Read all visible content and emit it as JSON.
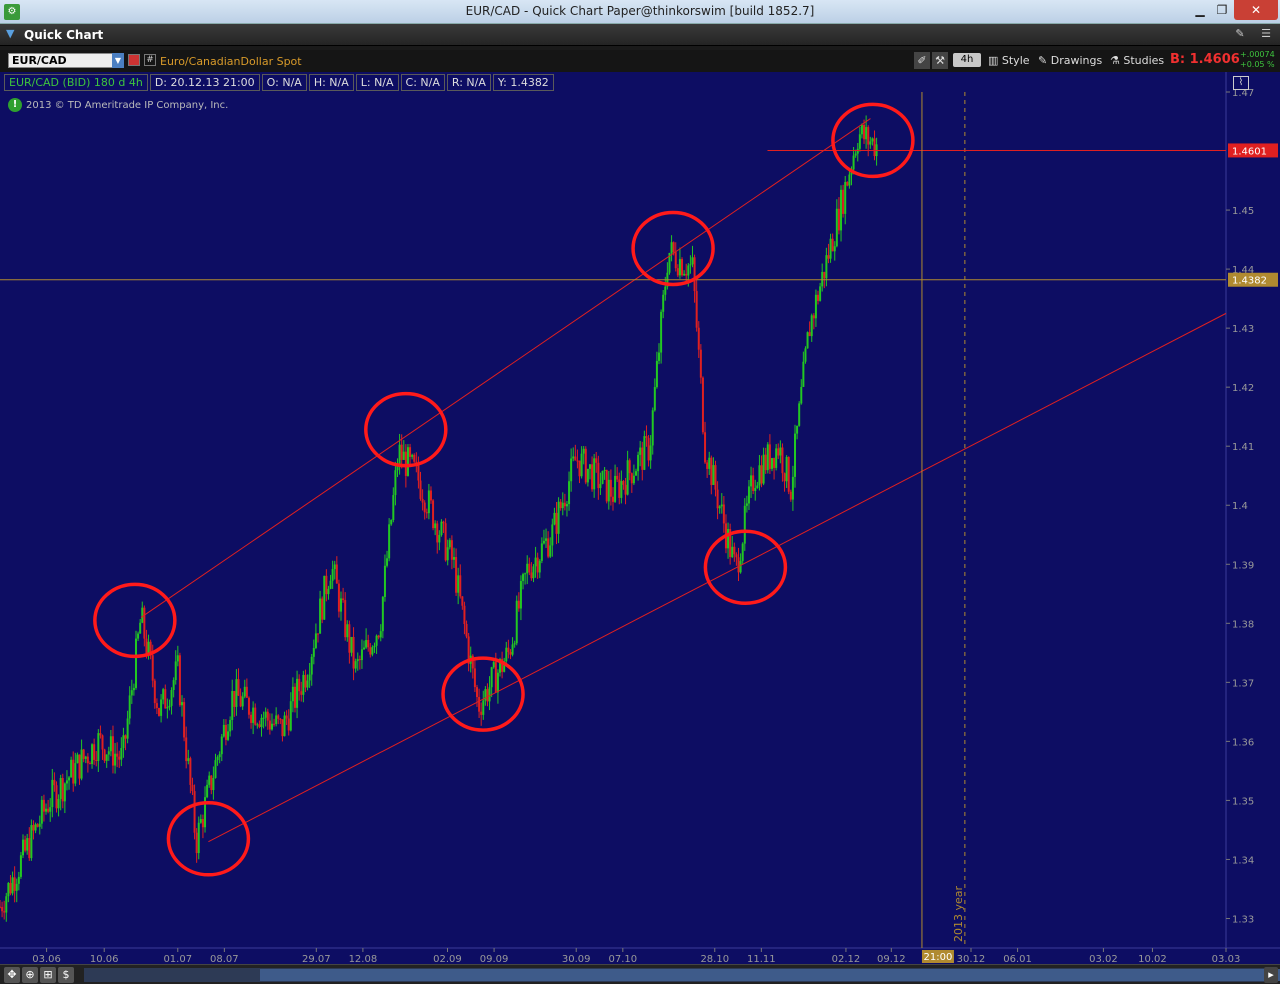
{
  "window": {
    "title": "EUR/CAD - Quick Chart Paper@thinkorswim [build 1852.7]"
  },
  "panel": {
    "title": "Quick Chart"
  },
  "toolbar": {
    "symbol": "EUR/CAD",
    "description": "Euro/CanadianDollar Spot",
    "aggregation": "4h",
    "style_label": "Style",
    "drawings_label": "Drawings",
    "studies_label": "Studies",
    "bid_label": "B: 1.4606",
    "change_abs": "+.00074",
    "change_pct": "+0.05 %"
  },
  "info": {
    "symbol": "EUR/CAD (BID) 180 d 4h",
    "date": "D: 20.12.13 21:00",
    "open": "O: N/A",
    "high": "H: N/A",
    "low": "L: N/A",
    "close": "C: N/A",
    "range": "R: N/A",
    "y": "Y: 1.4382"
  },
  "copyright": "2013 © TD Ameritrade IP Company, Inc.",
  "colors": {
    "background": "#0d0d63",
    "up": "#22c822",
    "down": "#e02020",
    "trendline": "#e02020",
    "cursor": "#b08a30",
    "price_line": "#e02020"
  },
  "chart_data": {
    "type": "candlestick",
    "ylim": [
      1.325,
      1.47
    ],
    "yticks": [
      1.33,
      1.34,
      1.35,
      1.36,
      1.37,
      1.38,
      1.39,
      1.4,
      1.41,
      1.42,
      1.43,
      1.44,
      1.45,
      1.47
    ],
    "xticks": [
      "03.06",
      "10.06",
      "01.07",
      "08.07",
      "29.07",
      "12.08",
      "02.09",
      "09.09",
      "30.09",
      "07.10",
      "28.10",
      "11.11",
      "02.12",
      "09.12",
      "30.12",
      "06.01",
      "03.02",
      "10.02",
      "03.03"
    ],
    "cursor_time_label": "21:00",
    "cursor_price_label": "1.4382",
    "last_price_label": "1.4601",
    "year_label": "2013 year",
    "price_path": [
      {
        "t": 0,
        "p": 1.332
      },
      {
        "t": 0.04,
        "p": 1.35
      },
      {
        "t": 0.08,
        "p": 1.36
      },
      {
        "t": 0.1,
        "p": 1.357
      },
      {
        "t": 0.115,
        "p": 1.381
      },
      {
        "t": 0.13,
        "p": 1.365
      },
      {
        "t": 0.145,
        "p": 1.372
      },
      {
        "t": 0.16,
        "p": 1.343
      },
      {
        "t": 0.19,
        "p": 1.368
      },
      {
        "t": 0.23,
        "p": 1.362
      },
      {
        "t": 0.25,
        "p": 1.372
      },
      {
        "t": 0.27,
        "p": 1.39
      },
      {
        "t": 0.29,
        "p": 1.372
      },
      {
        "t": 0.31,
        "p": 1.38
      },
      {
        "t": 0.325,
        "p": 1.409
      },
      {
        "t": 0.34,
        "p": 1.405
      },
      {
        "t": 0.37,
        "p": 1.39
      },
      {
        "t": 0.39,
        "p": 1.366
      },
      {
        "t": 0.415,
        "p": 1.375
      },
      {
        "t": 0.43,
        "p": 1.389
      },
      {
        "t": 0.45,
        "p": 1.395
      },
      {
        "t": 0.47,
        "p": 1.408
      },
      {
        "t": 0.5,
        "p": 1.402
      },
      {
        "t": 0.53,
        "p": 1.41
      },
      {
        "t": 0.545,
        "p": 1.443
      },
      {
        "t": 0.565,
        "p": 1.44
      },
      {
        "t": 0.575,
        "p": 1.41
      },
      {
        "t": 0.6,
        "p": 1.389
      },
      {
        "t": 0.615,
        "p": 1.405
      },
      {
        "t": 0.635,
        "p": 1.41
      },
      {
        "t": 0.645,
        "p": 1.403
      },
      {
        "t": 0.66,
        "p": 1.43
      },
      {
        "t": 0.685,
        "p": 1.45
      },
      {
        "t": 0.7,
        "p": 1.463
      },
      {
        "t": 0.715,
        "p": 1.461
      }
    ],
    "trendlines": [
      {
        "t1": 0.115,
        "p1": 1.381,
        "t2": 0.71,
        "p2": 1.4655
      },
      {
        "t1": 0.17,
        "p1": 1.343,
        "t2": 1.0,
        "p2": 1.4325
      }
    ],
    "circles": [
      {
        "t": 0.11,
        "p": 1.3805
      },
      {
        "t": 0.17,
        "p": 1.3435
      },
      {
        "t": 0.331,
        "p": 1.4128
      },
      {
        "t": 0.394,
        "p": 1.368
      },
      {
        "t": 0.549,
        "p": 1.4435
      },
      {
        "t": 0.608,
        "p": 1.3895
      },
      {
        "t": 0.712,
        "p": 1.4618
      }
    ],
    "last_price": 1.4601,
    "cursor_price": 1.4382,
    "cursor_t": 0.752,
    "year_t": 0.787
  }
}
